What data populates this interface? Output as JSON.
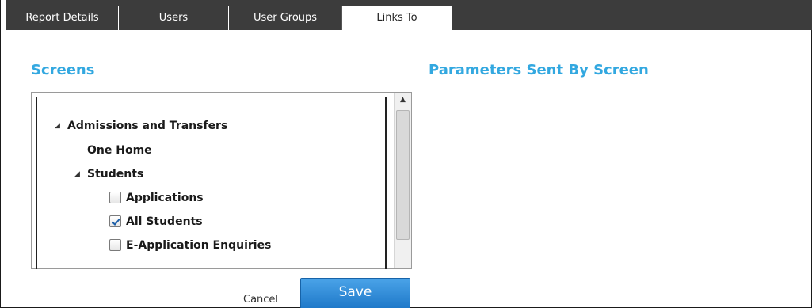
{
  "tabs": [
    {
      "label": "Report Details"
    },
    {
      "label": "Users"
    },
    {
      "label": "User Groups"
    },
    {
      "label": "Links To"
    }
  ],
  "screens_title": "Screens",
  "parameters_title": "Parameters Sent By Screen",
  "tree": {
    "root": "Admissions and Transfers",
    "one_home": "One Home",
    "students": "Students",
    "items": [
      {
        "label": "Applications",
        "checked": false
      },
      {
        "label": "All Students",
        "checked": true
      },
      {
        "label": "E-Application Enquiries",
        "checked": false
      }
    ]
  },
  "buttons": {
    "cancel": "Cancel",
    "save": "Save"
  },
  "colors": {
    "accent": "#33a8e0",
    "tabbar": "#3c3c3c",
    "save": "#2a86d6"
  },
  "icons": {
    "expanded": "triangle-expanded-icon",
    "scroll_up": "scroll-up-arrow-icon",
    "check": "checkmark-icon"
  }
}
